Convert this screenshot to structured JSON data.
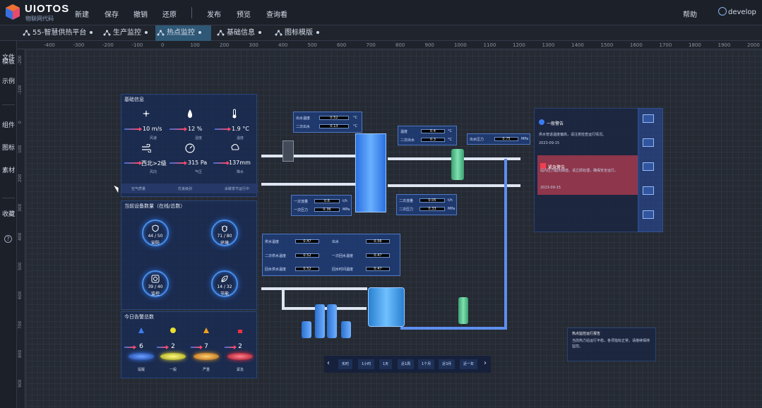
{
  "app": {
    "logo_text": "UIOTOS",
    "logo_sub": "物联网代码"
  },
  "menu": {
    "items": [
      "新建",
      "保存",
      "撤销",
      "还原",
      "发布",
      "预览",
      "查询看"
    ],
    "help": "帮助",
    "user": "develop"
  },
  "tabs": [
    {
      "label": "55-智慧供热平台"
    },
    {
      "label": "生产监控"
    },
    {
      "label": "热点监控"
    },
    {
      "label": "基础信息"
    },
    {
      "label": "图标模版"
    }
  ],
  "sidebar": {
    "items": [
      "文件",
      "模板",
      "示例",
      "组件",
      "图标",
      "素材",
      "收藏"
    ],
    "help_glyph": "?"
  },
  "ruler": {
    "h_ticks": [
      "-400",
      "-300",
      "-200",
      "-100",
      "0",
      "100",
      "200",
      "300",
      "400",
      "500",
      "600",
      "700",
      "800",
      "900",
      "1000",
      "1100",
      "1200",
      "1300",
      "1400",
      "1500",
      "1600",
      "1700",
      "1800",
      "1900",
      "2000"
    ],
    "v_ticks": [
      "-200",
      "-100",
      "0",
      "100",
      "200",
      "300",
      "400",
      "500",
      "600",
      "700",
      "800",
      "900"
    ]
  },
  "weather": {
    "title": "基础信息",
    "items": [
      {
        "icon": "fan-icon",
        "value": "10 m/s",
        "label": "风速"
      },
      {
        "icon": "drop-icon",
        "value": "12 %",
        "label": "湿度"
      },
      {
        "icon": "thermometer-icon",
        "value": "1.9 °C",
        "label": "温度"
      },
      {
        "icon": "wind-icon",
        "value": "西北>2级",
        "label": "风向"
      },
      {
        "icon": "gauge-icon",
        "value": "315 Pa",
        "label": "气压"
      },
      {
        "icon": "rain-icon",
        "value": "137mm",
        "label": "降水"
      }
    ],
    "footer": [
      "空气质量",
      "优良级别",
      "采暖季节运行中"
    ]
  },
  "devices": {
    "title": "当前设备数量（在线/总数）",
    "items": [
      {
        "icon": "shield-icon",
        "value": "44 / 50",
        "label": "安防"
      },
      {
        "icon": "bug-icon",
        "value": "71 / 80",
        "label": "环境"
      },
      {
        "icon": "camera-icon",
        "value": "39 / 40",
        "label": "监控"
      },
      {
        "icon": "leaf-icon",
        "value": "14 / 32",
        "label": "节能"
      }
    ]
  },
  "alarms": {
    "title": "今日告警总数",
    "items": [
      {
        "icon": "info-alarm-icon",
        "value": "6",
        "label": "提醒",
        "color": "#3a7df0"
      },
      {
        "icon": "warn-alarm-icon",
        "value": "2",
        "label": "一般",
        "color": "#e8e030"
      },
      {
        "icon": "triangle-alarm-icon",
        "value": "7",
        "label": "严重",
        "color": "#f0a020"
      },
      {
        "icon": "siren-alarm-icon",
        "value": "2",
        "label": "紧急",
        "color": "#f03040"
      }
    ]
  },
  "process": {
    "box1": {
      "rows": [
        "出水温度",
        "二次出水"
      ],
      "values": [
        "0.52",
        "0.13"
      ],
      "units": [
        "°C",
        "°C"
      ]
    },
    "box2": {
      "rows": [
        "温度",
        "二次出水"
      ],
      "values": [
        "0.4",
        "0.3"
      ],
      "units": [
        "°C",
        "°C"
      ]
    },
    "box3": {
      "rows": [
        "出水压力"
      ],
      "values": [
        "0.75"
      ],
      "units": [
        "MPa"
      ]
    },
    "box4": {
      "rows": [
        "一次流量",
        "一次压力"
      ],
      "values": [
        "0.6",
        "0.36"
      ],
      "units": [
        "t/h",
        "MPa"
      ]
    },
    "box5": {
      "rows": [
        "二次流量",
        "二次压力"
      ],
      "values": [
        "0.05",
        "0.33"
      ],
      "units": [
        "t/h",
        "MPa"
      ]
    },
    "box6": {
      "rows": [
        "供水温度",
        "二次供水温度",
        "回水供水温度",
        "出水",
        "一次回水温度",
        "回水时间温度"
      ],
      "values": [
        "0.47",
        "0.52",
        "0.52",
        "0.56",
        "0.47",
        "0.47"
      ]
    }
  },
  "timebar": {
    "buttons": [
      "实时",
      "1小时",
      "1天",
      "近1周",
      "1个月",
      "近3月",
      "近一年"
    ],
    "prev": "‹",
    "next": "›"
  },
  "notices": {
    "normal": {
      "title": "一般警告",
      "text": "供水管道温度偏高，请注意检查运行情况。",
      "time": "2023-09-15",
      "code": "告警编号"
    },
    "urgent": {
      "title": "紧急警告",
      "text": "站内压力超出阈值，请立即处理，确保安全运行。",
      "time": "2023-09-15",
      "code": "告警编号"
    }
  },
  "bottom_notice": {
    "title": "热点监控运行报告",
    "text": "当前热力站运行平稳，各项指标正常，请继续保持监控。"
  }
}
